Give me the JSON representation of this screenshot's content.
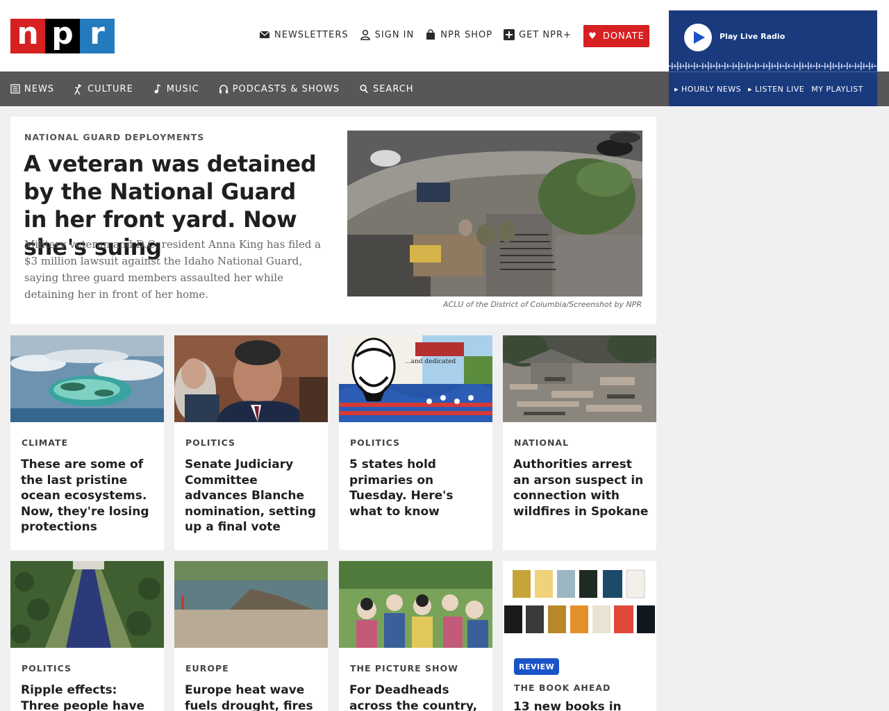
{
  "brand": {
    "letters": [
      "n",
      "p",
      "r"
    ],
    "colors": [
      "#d62021",
      "#000000",
      "#237bbd"
    ]
  },
  "utility": {
    "newsletters": "NEWSLETTERS",
    "sign_in": "SIGN IN",
    "shop": "NPR SHOP",
    "get_plus": "GET NPR+",
    "donate": "DONATE"
  },
  "nav": {
    "news": "NEWS",
    "culture": "CULTURE",
    "music": "MUSIC",
    "podcasts": "PODCASTS & SHOWS",
    "search": "SEARCH"
  },
  "radio": {
    "title": "Play Live Radio",
    "hourly": "HOURLY NEWS",
    "listen_live": "LISTEN LIVE",
    "playlist": "MY PLAYLIST"
  },
  "hero": {
    "slug": "NATIONAL GUARD DEPLOYMENTS",
    "title": "A veteran was detained by the National Guard in her front yard. Now she's suing",
    "teaser": "Military veteran and D.C. resident Anna King has filed a $3 million lawsuit against the Idaho National Guard, saying three guard members assaulted her while detaining her in front of her home.",
    "credit": "ACLU of the District of Columbia/Screenshot by NPR"
  },
  "cards": [
    {
      "slug": "CLIMATE",
      "title": "These are some of the last pristine ocean ecosystems. Now, they're losing protections"
    },
    {
      "slug": "POLITICS",
      "title": "Senate Judiciary Committee advances Blanche nomination, setting up a final vote"
    },
    {
      "slug": "POLITICS",
      "title": "5 states hold primaries on Tuesday. Here's what to know"
    },
    {
      "slug": "NATIONAL",
      "title": "Authorities arrest an arson suspect in connection with wildfires in Spokane"
    },
    {
      "slug": "POLITICS",
      "title": "Ripple effects: Three people have"
    },
    {
      "slug": "EUROPE",
      "title": "Europe heat wave fuels drought, fires"
    },
    {
      "slug": "THE PICTURE SHOW",
      "title": "For Deadheads across the country, the"
    },
    {
      "badge": "REVIEW",
      "slug": "THE BOOK AHEAD",
      "title": "13 new books in"
    }
  ]
}
